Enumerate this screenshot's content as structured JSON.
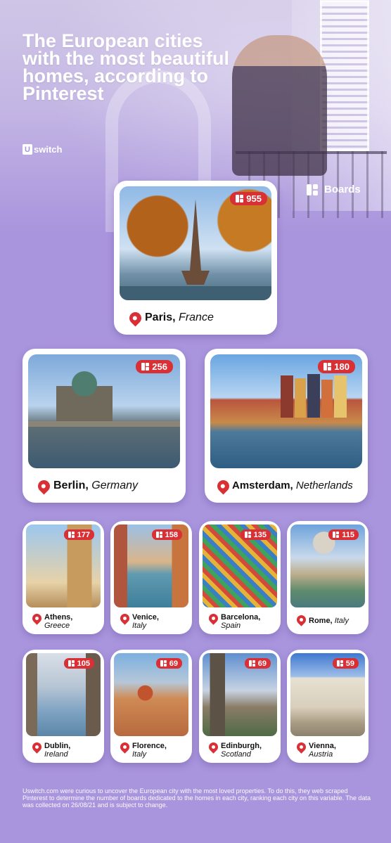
{
  "header": {
    "title": "The European cities with the most beautiful homes, according to Pinterest",
    "logo_mark": "U",
    "logo_text": "switch"
  },
  "legend": {
    "icon": "boards-icon",
    "label": "Boards"
  },
  "cities": [
    {
      "city": "Paris,",
      "country": "France",
      "boards": "955"
    },
    {
      "city": "Berlin,",
      "country": "Germany",
      "boards": "256"
    },
    {
      "city": "Amsterdam,",
      "country": "Netherlands",
      "boards": "180"
    },
    {
      "city": "Athens,",
      "country": "Greece",
      "boards": "177"
    },
    {
      "city": "Venice,",
      "country": "Italy",
      "boards": "158"
    },
    {
      "city": "Barcelona,",
      "country": "Spain",
      "boards": "135"
    },
    {
      "city": "Rome,",
      "country": "Italy",
      "boards": "115"
    },
    {
      "city": "Dublin,",
      "country": "Ireland",
      "boards": "105"
    },
    {
      "city": "Florence,",
      "country": "Italy",
      "boards": "69"
    },
    {
      "city": "Edinburgh,",
      "country": "Scotland",
      "boards": "69"
    },
    {
      "city": "Vienna,",
      "country": "Austria",
      "boards": "59"
    }
  ],
  "colors": {
    "background": "#a995dd",
    "accent": "#d93036",
    "card": "#ffffff"
  },
  "footnote": "Uswitch.com were curious to uncover the European city with the most loved properties. To do this, they web scraped Pinterest to determine the number of boards dedicated to the homes in each city, ranking each city on this variable. The data was collected on 26/08/21 and is subject to change."
}
